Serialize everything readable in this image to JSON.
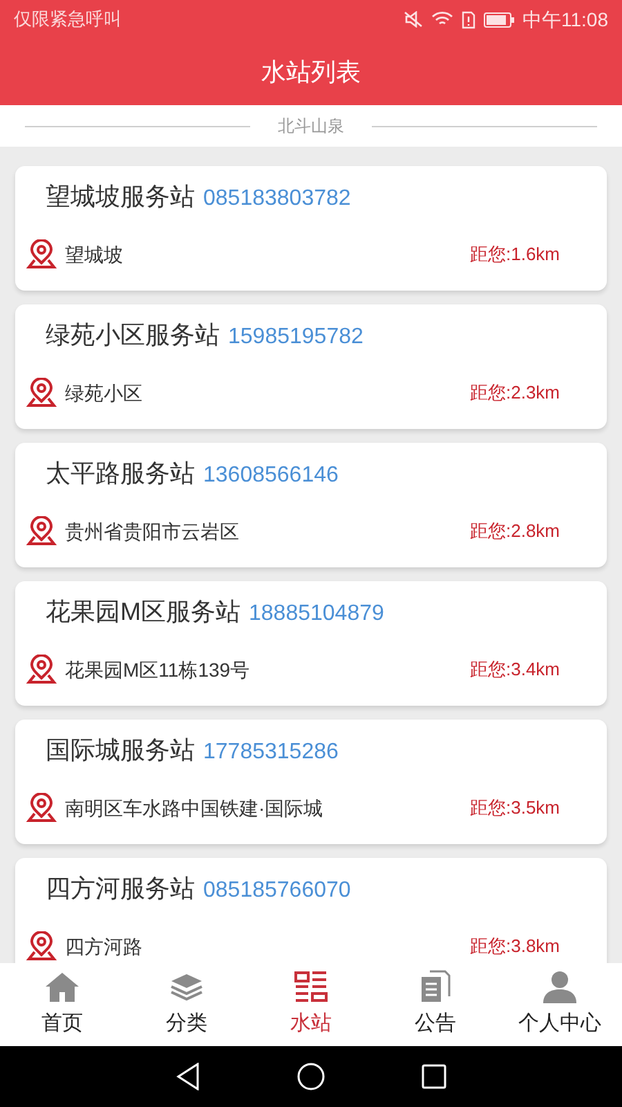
{
  "status_bar": {
    "carrier": "仅限紧急呼叫",
    "time": "中午11:08"
  },
  "header": {
    "title": "水站列表"
  },
  "section": {
    "label": "北斗山泉"
  },
  "stations": [
    {
      "name": "望城坡服务站",
      "phone": "085183803782",
      "address": "望城坡",
      "distance": "距您:1.6km"
    },
    {
      "name": "绿苑小区服务站",
      "phone": "15985195782",
      "address": "绿苑小区",
      "distance": "距您:2.3km"
    },
    {
      "name": "太平路服务站",
      "phone": "13608566146",
      "address": "贵州省贵阳市云岩区",
      "distance": "距您:2.8km"
    },
    {
      "name": "花果园M区服务站",
      "phone": "18885104879",
      "address": "花果园M区11栋139号",
      "distance": "距您:3.4km"
    },
    {
      "name": "国际城服务站",
      "phone": "17785315286",
      "address": "南明区车水路中国铁建·国际城",
      "distance": "距您:3.5km"
    },
    {
      "name": "四方河服务站",
      "phone": "085185766070",
      "address": "四方河路",
      "distance": "距您:3.8km"
    }
  ],
  "tab_bar": [
    {
      "label": "首页",
      "kind": "home",
      "selected": false
    },
    {
      "label": "分类",
      "kind": "layers",
      "selected": false
    },
    {
      "label": "水站",
      "kind": "list",
      "selected": true
    },
    {
      "label": "公告",
      "kind": "docs",
      "selected": false
    },
    {
      "label": "个人中心",
      "kind": "person",
      "selected": false
    }
  ]
}
